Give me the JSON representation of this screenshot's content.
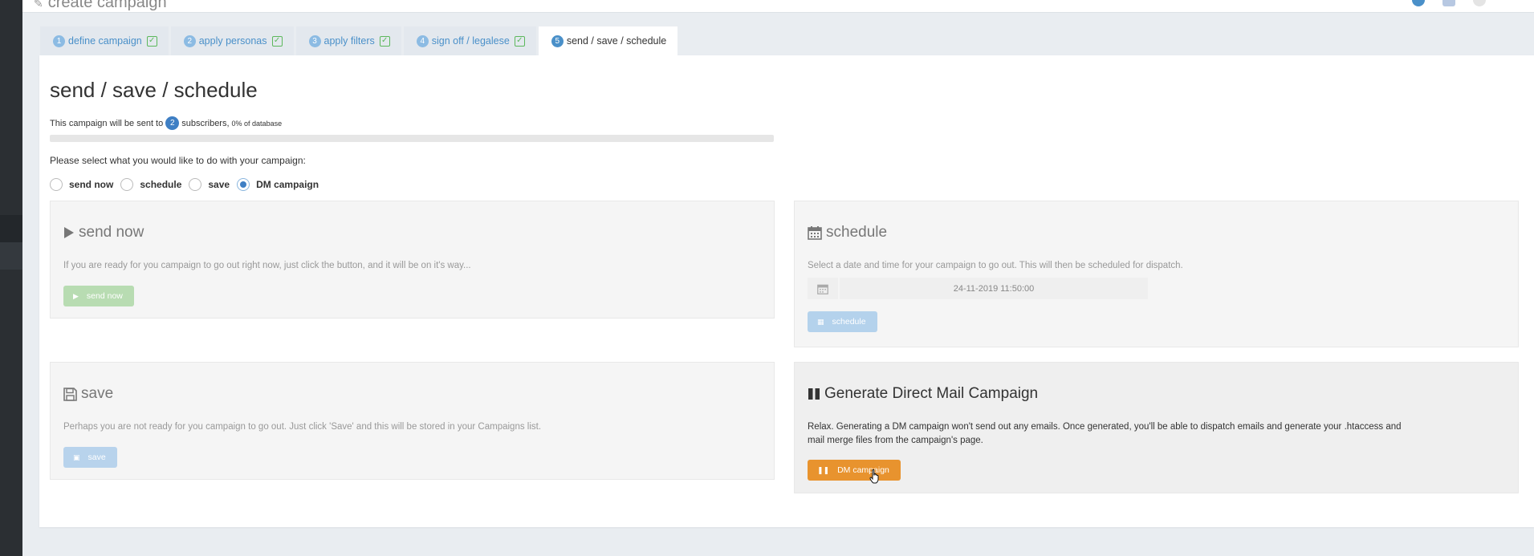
{
  "header": {
    "title": "create campaign"
  },
  "tabs": [
    {
      "num": "1",
      "label": "define campaign"
    },
    {
      "num": "2",
      "label": "apply personas"
    },
    {
      "num": "3",
      "label": "apply filters"
    },
    {
      "num": "4",
      "label": "sign off / legalese"
    },
    {
      "num": "5",
      "label": "send / save / schedule"
    }
  ],
  "main": {
    "title": "send / save / schedule",
    "summary_prefix": "This campaign will be sent to",
    "subscriber_count": "2",
    "summary_suffix": "subscribers,",
    "database_pct": "0% of database",
    "progress_fraction": 0.0,
    "prompt": "Please select what you would like to do with your campaign:",
    "options": [
      {
        "label": "send now",
        "checked": false
      },
      {
        "label": "schedule",
        "checked": false
      },
      {
        "label": "save",
        "checked": false
      },
      {
        "label": "DM campaign",
        "checked": true
      }
    ]
  },
  "send_now": {
    "title": "send now",
    "description": "If you are ready for you campaign to go out right now, just click the button, and it will be on it's way...",
    "button": "send now"
  },
  "schedule": {
    "title": "schedule",
    "description": "Select a date and time for your campaign to go out. This will then be scheduled for dispatch.",
    "datetime": "24-11-2019 11:50:00",
    "button": "schedule"
  },
  "save": {
    "title": "save",
    "description": "Perhaps you are not ready for you campaign to go out. Just click 'Save' and this will be stored in your Campaigns list.",
    "button": "save"
  },
  "dm": {
    "title": "Generate Direct Mail Campaign",
    "description": "Relax. Generating a DM campaign won't send out any emails. Once generated, you'll be able to dispatch emails and generate your .htaccess and mail merge files from the campaign's page.",
    "button": "DM campaign"
  },
  "colors": {
    "accent": "#3f7fc4",
    "dm_button": "#e8932e",
    "check": "#5cb85c"
  }
}
